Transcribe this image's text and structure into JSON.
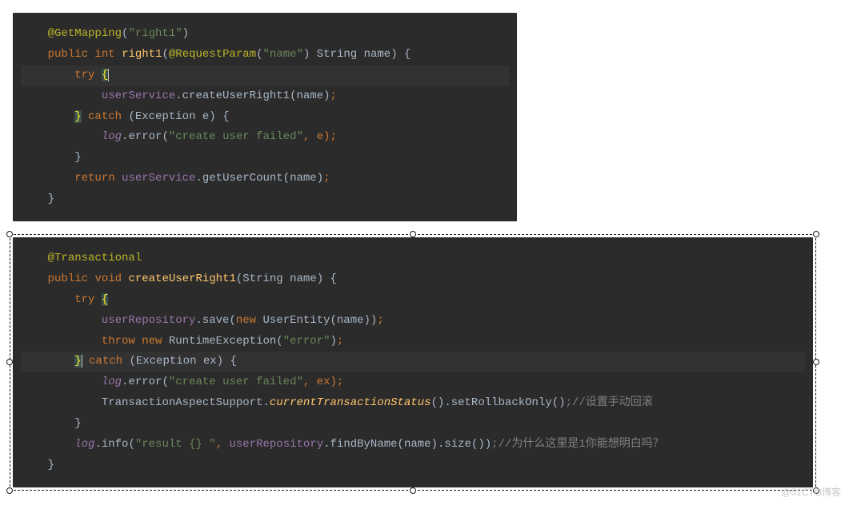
{
  "block1": {
    "anno_get": "@GetMapping",
    "str_right1": "\"right1\"",
    "kw_public": "public",
    "kw_int": "int",
    "method_right1": "right1",
    "anno_reqparam": "@RequestParam",
    "str_name": "\"name\"",
    "type_string": "String",
    "param_name": "name",
    "kw_try": "try",
    "brace_open": "{",
    "field_userService": "userService",
    "call_createUserRight1": ".createUserRight1(name)",
    "brace_close": "}",
    "kw_catch": "catch",
    "catch_sig": "(Exception e) {",
    "field_log": "log",
    "call_error": ".error(",
    "str_cuf": "\"create user failed\"",
    "err_tail": ", e)",
    "kw_return": "return",
    "call_getUserCount": ".getUserCount(name)"
  },
  "block2": {
    "anno_trans": "@Transactional",
    "kw_public": "public",
    "kw_void": "void",
    "method_cur1": "createUserRight1",
    "sig_tail": "(String name) {",
    "kw_try": "try",
    "brace_open": "{",
    "field_userRepo": "userRepository",
    "call_save_pre": ".save(",
    "kw_new": "new",
    "ctor_ue": " UserEntity(name))",
    "kw_throw": "throw",
    "ctor_rte": " RuntimeException(",
    "str_error": "\"error\"",
    "rte_tail": ")",
    "brace_close": "}",
    "kw_catch": "catch",
    "catch_sig": "(Exception ex) {",
    "field_log": "log",
    "call_error": ".error(",
    "str_cuf": "\"create user failed\"",
    "err_tail": ", ex)",
    "tas": "TransactionAspectSupport.",
    "cts": "currentTransactionStatus",
    "sro": "().setRollbackOnly()",
    "comment1": ";//设置手动回滚",
    "call_info": ".info(",
    "str_result": "\"result {} \"",
    "info_mid": ", ",
    "call_findByName": ".findByName(name).size())",
    "comment2": ";//为什么这里是1你能想明白吗？"
  },
  "watermark": "@51CTO博客"
}
